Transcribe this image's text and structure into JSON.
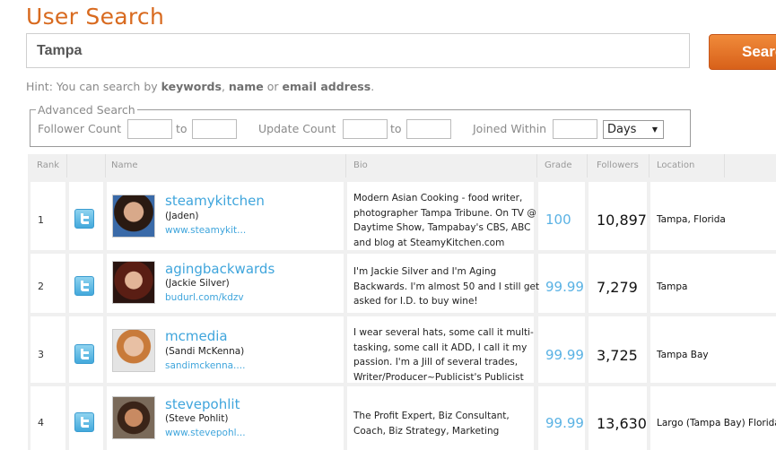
{
  "page": {
    "title": "User Search"
  },
  "search": {
    "value": "Tampa",
    "button_label": "Search",
    "hint_prefix": "Hint: You can search by ",
    "hint_k1": "keywords",
    "hint_sep1": ", ",
    "hint_k2": "name",
    "hint_sep2": " or ",
    "hint_k3": "email address",
    "hint_suffix": "."
  },
  "advanced": {
    "legend": "Advanced Search",
    "follower_label": "Follower Count",
    "to1": "to",
    "update_label": "Update Count",
    "to2": "to",
    "joined_label": "Joined Within",
    "days_value": "Days"
  },
  "table": {
    "headers": {
      "rank": "Rank",
      "name": "Name",
      "bio": "Bio",
      "grade": "Grade",
      "followers": "Followers",
      "location": "Location"
    },
    "rows": [
      {
        "rank": "1",
        "username": "steamykitchen",
        "realname": "(Jaden)",
        "url": "www.steamykit...",
        "bio": [
          "Modern Asian Cooking - food writer,",
          "photographer Tampa Tribune. On TV @",
          "Daytime Show, Tampabay's CBS, ABC",
          "and blog at SteamyKitchen.com"
        ],
        "grade": "100",
        "followers": "10,897",
        "location": "Tampa, Florida"
      },
      {
        "rank": "2",
        "username": "agingbackwards",
        "realname": "(Jackie Silver)",
        "url": "budurl.com/kdzv",
        "bio": [
          "I'm Jackie Silver and I'm Aging",
          "Backwards. I'm almost 50 and I still get",
          "asked for I.D. to buy wine!"
        ],
        "grade": "99.99",
        "followers": "7,279",
        "location": "Tampa"
      },
      {
        "rank": "3",
        "username": "mcmedia",
        "realname": "(Sandi McKenna)",
        "url": "sandimckenna....",
        "bio": [
          "I wear several hats, some call it multi-",
          "tasking, some call it ADD, I call it my",
          "passion. I'm a Jill of several trades,",
          "Writer/Producer~Publicist's Publicist"
        ],
        "grade": "99.99",
        "followers": "3,725",
        "location": "Tampa Bay"
      },
      {
        "rank": "4",
        "username": "stevepohlit",
        "realname": "(Steve Pohlit)",
        "url": "www.stevepohl...",
        "bio": [
          "The Profit Expert, Biz Consultant,",
          "Coach, Biz Strategy, Marketing"
        ],
        "grade": "99.99",
        "followers": "13,630",
        "location": "Largo (Tampa Bay) Florida"
      }
    ]
  },
  "colors": {
    "accent": "#d86a1f",
    "link": "#3fa5dc",
    "grade": "#5ab2e4"
  }
}
